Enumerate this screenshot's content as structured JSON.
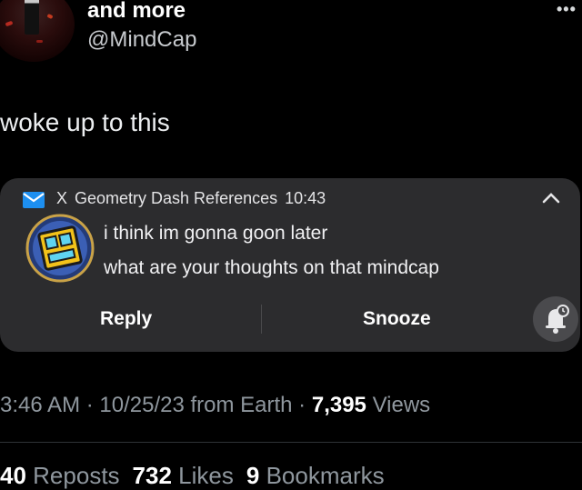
{
  "author": {
    "display_name": "and more",
    "handle": "@MindCap"
  },
  "more_icon": "ellipsis-icon",
  "tweet": {
    "text": "woke up to this"
  },
  "notification": {
    "app_prefix": "X",
    "sender": "Geometry Dash References",
    "time": "10:43",
    "line1": "i think im gonna goon later",
    "line2": "what are your thoughts on that mindcap",
    "reply_label": "Reply",
    "snooze_label": "Snooze",
    "icons": [
      "mail-icon",
      "chevron-up-icon",
      "geometry-dash-app-icon",
      "snooze-bell-icon"
    ]
  },
  "meta": {
    "time": "3:46 AM",
    "date": "10/25/23",
    "source": "from Earth",
    "views_count": "7,395",
    "views_label": "Views"
  },
  "stats": {
    "reposts_count": "40",
    "reposts_label": "Reposts",
    "likes_count": "732",
    "likes_label": "Likes",
    "bookmarks_count": "9",
    "bookmarks_label": "Bookmarks"
  },
  "colors": {
    "background": "#000000",
    "card": "#2c2c2e",
    "muted_text": "#8f979e",
    "mail_blue": "#1d8ff0"
  }
}
